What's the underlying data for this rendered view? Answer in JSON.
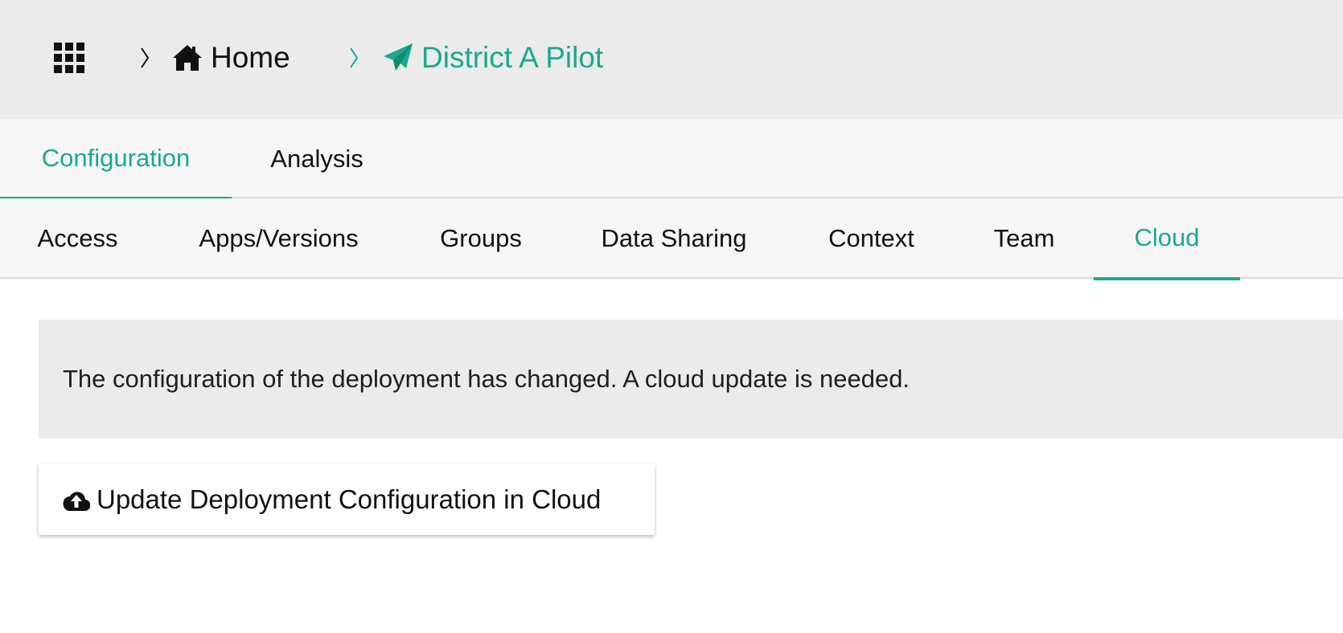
{
  "header": {
    "apps_icon": "grid-icon",
    "breadcrumb": {
      "separator_icon": "chevron-right-icon",
      "home": {
        "label": "Home",
        "icon": "home-icon"
      },
      "current": {
        "label": "District A Pilot",
        "icon": "paper-plane-icon"
      }
    }
  },
  "primary_tabs": [
    {
      "label": "Configuration",
      "active": true
    },
    {
      "label": "Analysis",
      "active": false
    }
  ],
  "secondary_tabs": [
    {
      "label": "Access",
      "active": false
    },
    {
      "label": "Apps/Versions",
      "active": false
    },
    {
      "label": "Groups",
      "active": false
    },
    {
      "label": "Data Sharing",
      "active": false
    },
    {
      "label": "Context",
      "active": false
    },
    {
      "label": "Team",
      "active": false
    },
    {
      "label": "Cloud",
      "active": true
    }
  ],
  "main": {
    "notice_text": "The configuration of the deployment has changed. A cloud update is needed.",
    "update_button": {
      "label": "Update Deployment Configuration in Cloud",
      "icon": "cloud-upload-icon"
    }
  },
  "colors": {
    "accent": "#1aa98c",
    "topbar_bg": "#ebebeb",
    "tabbar_bg": "#f6f6f6",
    "notice_bg": "#ebebeb"
  }
}
